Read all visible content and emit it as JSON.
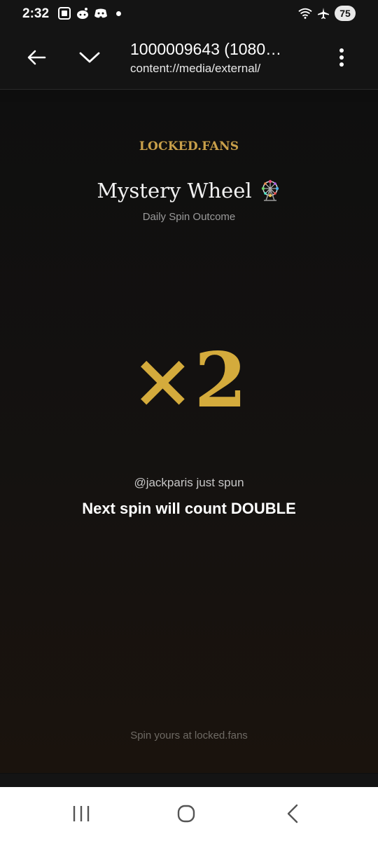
{
  "status_bar": {
    "time": "2:32",
    "battery": "75",
    "left_icons": [
      "screenshot-icon",
      "reddit-icon",
      "discord-icon",
      "notification-dot"
    ],
    "right_icons": [
      "wifi-icon",
      "airplane-icon",
      "battery-icon"
    ]
  },
  "app_bar": {
    "title": "1000009643 (1080…",
    "uri": "content://media/external/",
    "icons": [
      "back-arrow-icon",
      "chevron-down-icon",
      "more-vert-icon"
    ]
  },
  "content": {
    "brand": "LOCKED.FANS",
    "title": "Mystery Wheel",
    "title_icon": "ferris-wheel-icon",
    "subtitle": "Daily Spin Outcome",
    "multiplier": "×2",
    "spun_line": "@jackparis just spun",
    "headline": "Next spin will count DOUBLE",
    "footer": "Spin yours at locked.fans",
    "accent_color": "#d4ab3c",
    "brand_color": "#c9a04a"
  },
  "nav_bar": {
    "icons": [
      "recents-icon",
      "home-icon",
      "back-icon"
    ]
  }
}
